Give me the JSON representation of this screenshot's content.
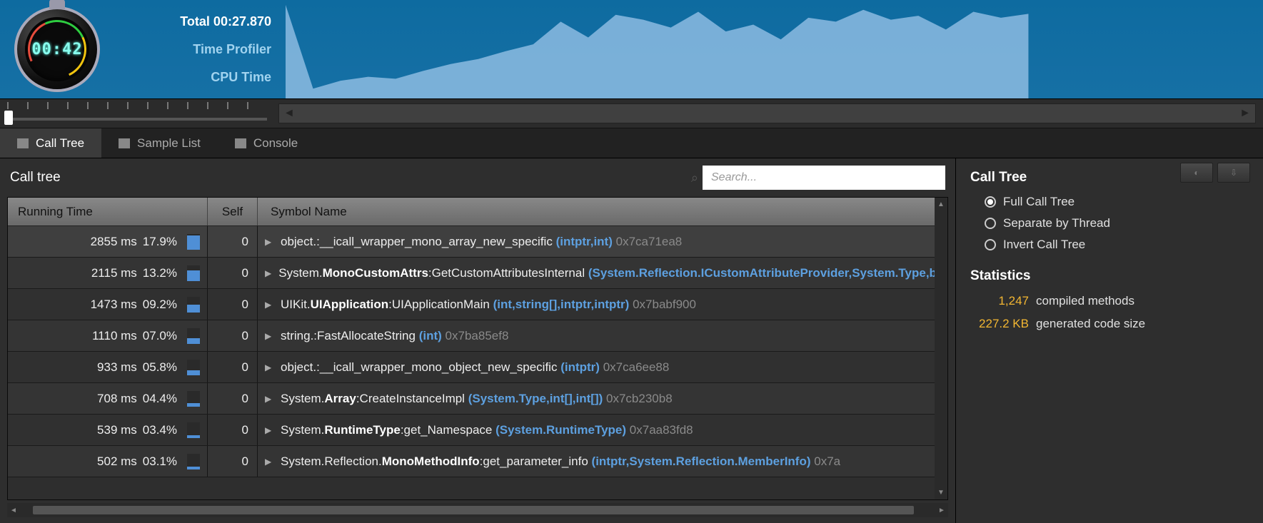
{
  "header": {
    "stopwatch_display": "00:42",
    "total_label": "Total 00:27.870",
    "profiler_label": "Time Profiler",
    "metric_label": "CPU Time"
  },
  "chart_data": {
    "type": "area",
    "title": "CPU Time",
    "x": [
      0,
      1,
      2,
      3,
      4,
      5,
      6,
      7,
      8,
      9,
      10,
      11,
      12,
      13,
      14,
      15,
      16,
      17,
      18,
      19,
      20,
      21,
      22,
      23,
      24,
      25,
      26,
      27
    ],
    "values": [
      95,
      10,
      18,
      22,
      20,
      28,
      35,
      40,
      48,
      55,
      78,
      62,
      85,
      80,
      72,
      88,
      68,
      75,
      60,
      82,
      78,
      90,
      80,
      84,
      70,
      88,
      82,
      86
    ],
    "ylim": [
      0,
      100
    ]
  },
  "tabs": [
    {
      "id": "call-tree",
      "label": "Call Tree",
      "active": true
    },
    {
      "id": "sample-list",
      "label": "Sample List",
      "active": false
    },
    {
      "id": "console",
      "label": "Console",
      "active": false
    }
  ],
  "toolbar": {
    "title": "Call tree",
    "search_placeholder": "Search..."
  },
  "columns": {
    "running_time": "Running Time",
    "self": "Self",
    "symbol": "Symbol Name"
  },
  "rows": [
    {
      "ms": "2855 ms",
      "pct": "17.9%",
      "barPct": 90,
      "self": "0",
      "ns": "object.",
      "cls": "",
      "mem": ":__icall_wrapper_mono_array_new_specific",
      "sig": "(intptr,int)",
      "addr": "0x7ca71ea8"
    },
    {
      "ms": "2115 ms",
      "pct": "13.2%",
      "barPct": 66,
      "self": "0",
      "ns": "System.",
      "cls": "MonoCustomAttrs",
      "mem": ":GetCustomAttributesInternal",
      "sig": "(System.Reflection.ICustomAttributeProvider,System.Type,bool)",
      "addr": ""
    },
    {
      "ms": "1473 ms",
      "pct": "09.2%",
      "barPct": 46,
      "self": "0",
      "ns": "UIKit.",
      "cls": "UIApplication",
      "mem": ":UIApplicationMain",
      "sig": "(int,string[],intptr,intptr)",
      "addr": "0x7babf900"
    },
    {
      "ms": "1110 ms",
      "pct": "07.0%",
      "barPct": 35,
      "self": "0",
      "ns": "string.",
      "cls": "",
      "mem": ":FastAllocateString",
      "sig": "(int)",
      "addr": "0x7ba85ef8"
    },
    {
      "ms": "933 ms",
      "pct": "05.8%",
      "barPct": 29,
      "self": "0",
      "ns": "object.",
      "cls": "",
      "mem": ":__icall_wrapper_mono_object_new_specific",
      "sig": "(intptr)",
      "addr": "0x7ca6ee88"
    },
    {
      "ms": "708 ms",
      "pct": "04.4%",
      "barPct": 22,
      "self": "0",
      "ns": "System.",
      "cls": "Array",
      "mem": ":CreateInstanceImpl",
      "sig": "(System.Type,int[],int[])",
      "addr": "0x7cb230b8"
    },
    {
      "ms": "539 ms",
      "pct": "03.4%",
      "barPct": 17,
      "self": "0",
      "ns": "System.",
      "cls": "RuntimeType",
      "mem": ":get_Namespace",
      "sig": "(System.RuntimeType)",
      "addr": "0x7aa83fd8"
    },
    {
      "ms": "502 ms",
      "pct": "03.1%",
      "barPct": 15,
      "self": "0",
      "ns": "System.Reflection.",
      "cls": "MonoMethodInfo",
      "mem": ":get_parameter_info",
      "sig": "(intptr,System.Reflection.MemberInfo)",
      "addr": "0x7a"
    }
  ],
  "side": {
    "title": "Call Tree",
    "options": [
      {
        "label": "Full Call Tree",
        "checked": true
      },
      {
        "label": "Separate by Thread",
        "checked": false
      },
      {
        "label": "Invert Call Tree",
        "checked": false
      }
    ],
    "stats_title": "Statistics",
    "stats": [
      {
        "value": "1,247",
        "label": "compiled methods"
      },
      {
        "value": "227.2 KB",
        "label": "generated code size"
      }
    ]
  }
}
